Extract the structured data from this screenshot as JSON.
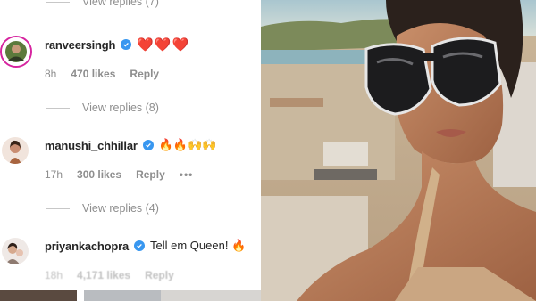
{
  "comments": {
    "top_view_replies": "View replies (7)",
    "items": [
      {
        "username": "ranveersingh",
        "text": "❤️❤️❤️",
        "time": "8h",
        "likes": "470 likes",
        "reply": "Reply",
        "view_replies": "View replies (8)"
      },
      {
        "username": "manushi_chhillar",
        "text": "🔥🔥🙌🙌",
        "time": "17h",
        "likes": "300 likes",
        "reply": "Reply",
        "more": "•••",
        "view_replies": "View replies (4)"
      },
      {
        "username": "priyankachopra",
        "text": "Tell em Queen! 🔥",
        "time": "18h",
        "likes": "4,171 likes",
        "reply": "Reply"
      }
    ]
  },
  "colors": {
    "verified": "#3897f0",
    "heart": "#ed4956",
    "muted": "#8e8e8e"
  }
}
